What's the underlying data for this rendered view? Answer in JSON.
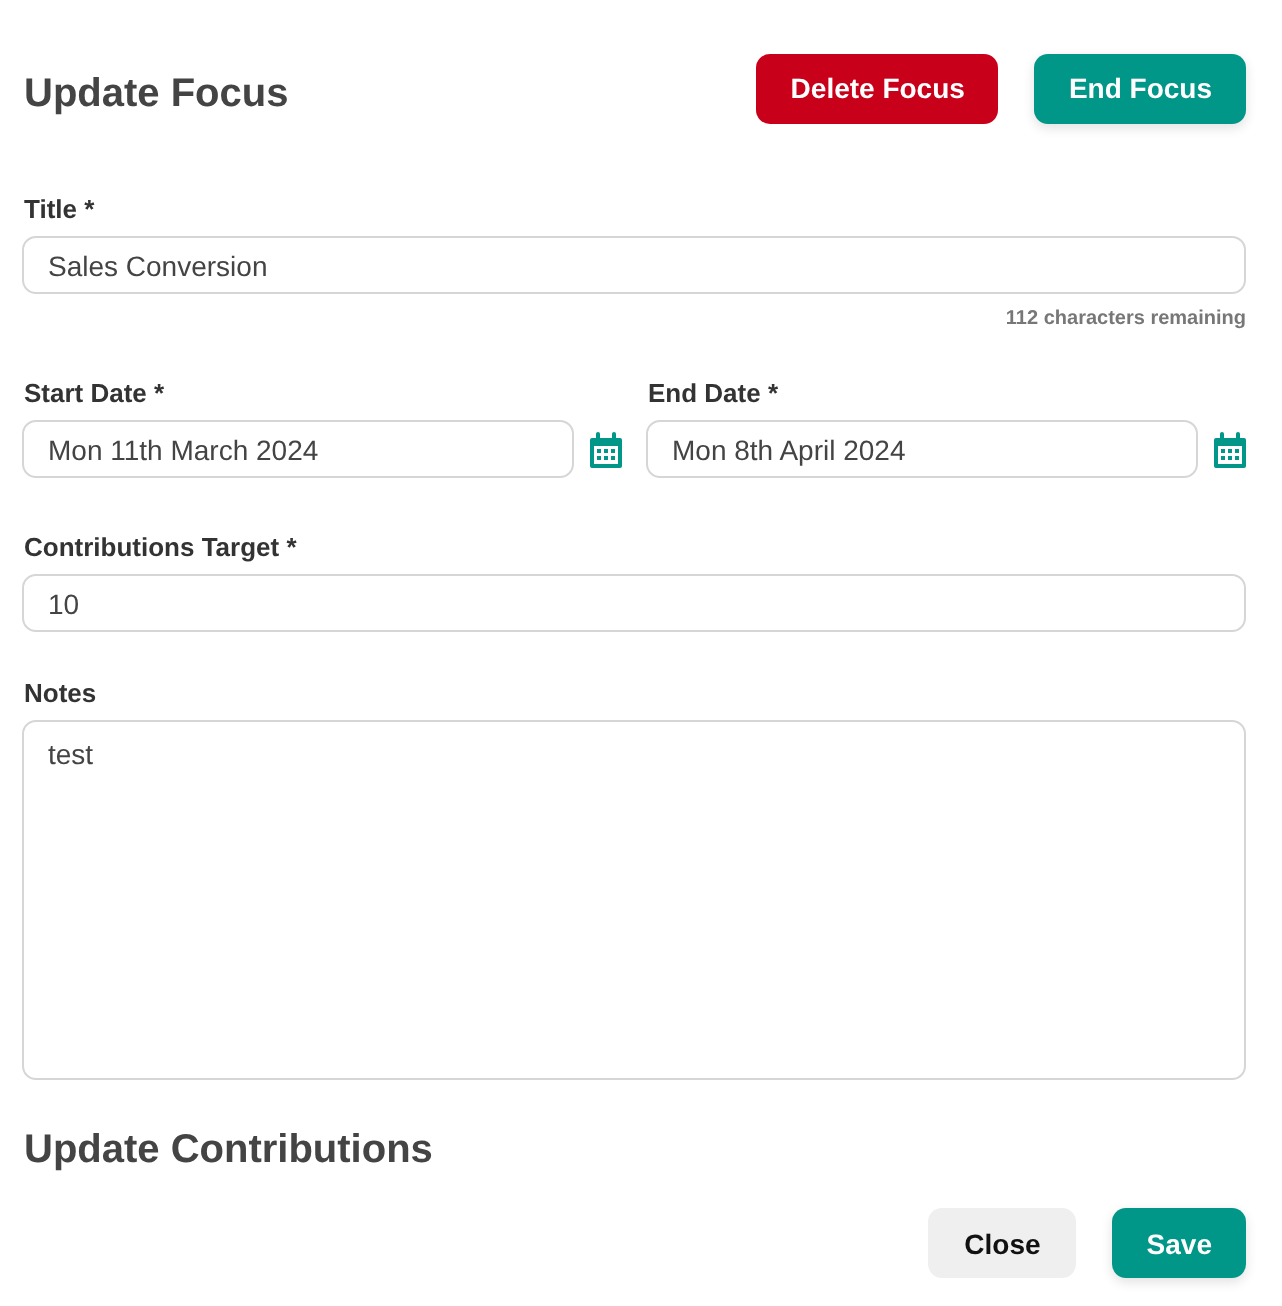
{
  "heading": "Update Focus",
  "header_buttons": [
    {
      "label": "Delete Focus",
      "kind": "danger"
    },
    {
      "label": "End Focus",
      "kind": "primary"
    }
  ],
  "title_field": {
    "label": "Title *",
    "value": "Sales Conversion",
    "hint": "112 characters remaining"
  },
  "dates": [
    {
      "label": "Start Date *",
      "value": "Mon 11th March 2024"
    },
    {
      "label": "End Date *",
      "value": "Mon 8th April 2024"
    }
  ],
  "target_field": {
    "label": "Contributions Target *",
    "value": "10"
  },
  "notes_field": {
    "label": "Notes",
    "value": "test"
  },
  "section_heading": "Update Contributions",
  "footer_buttons": [
    {
      "label": "Close",
      "kind": "secondary"
    },
    {
      "label": "Save",
      "kind": "primary"
    }
  ]
}
